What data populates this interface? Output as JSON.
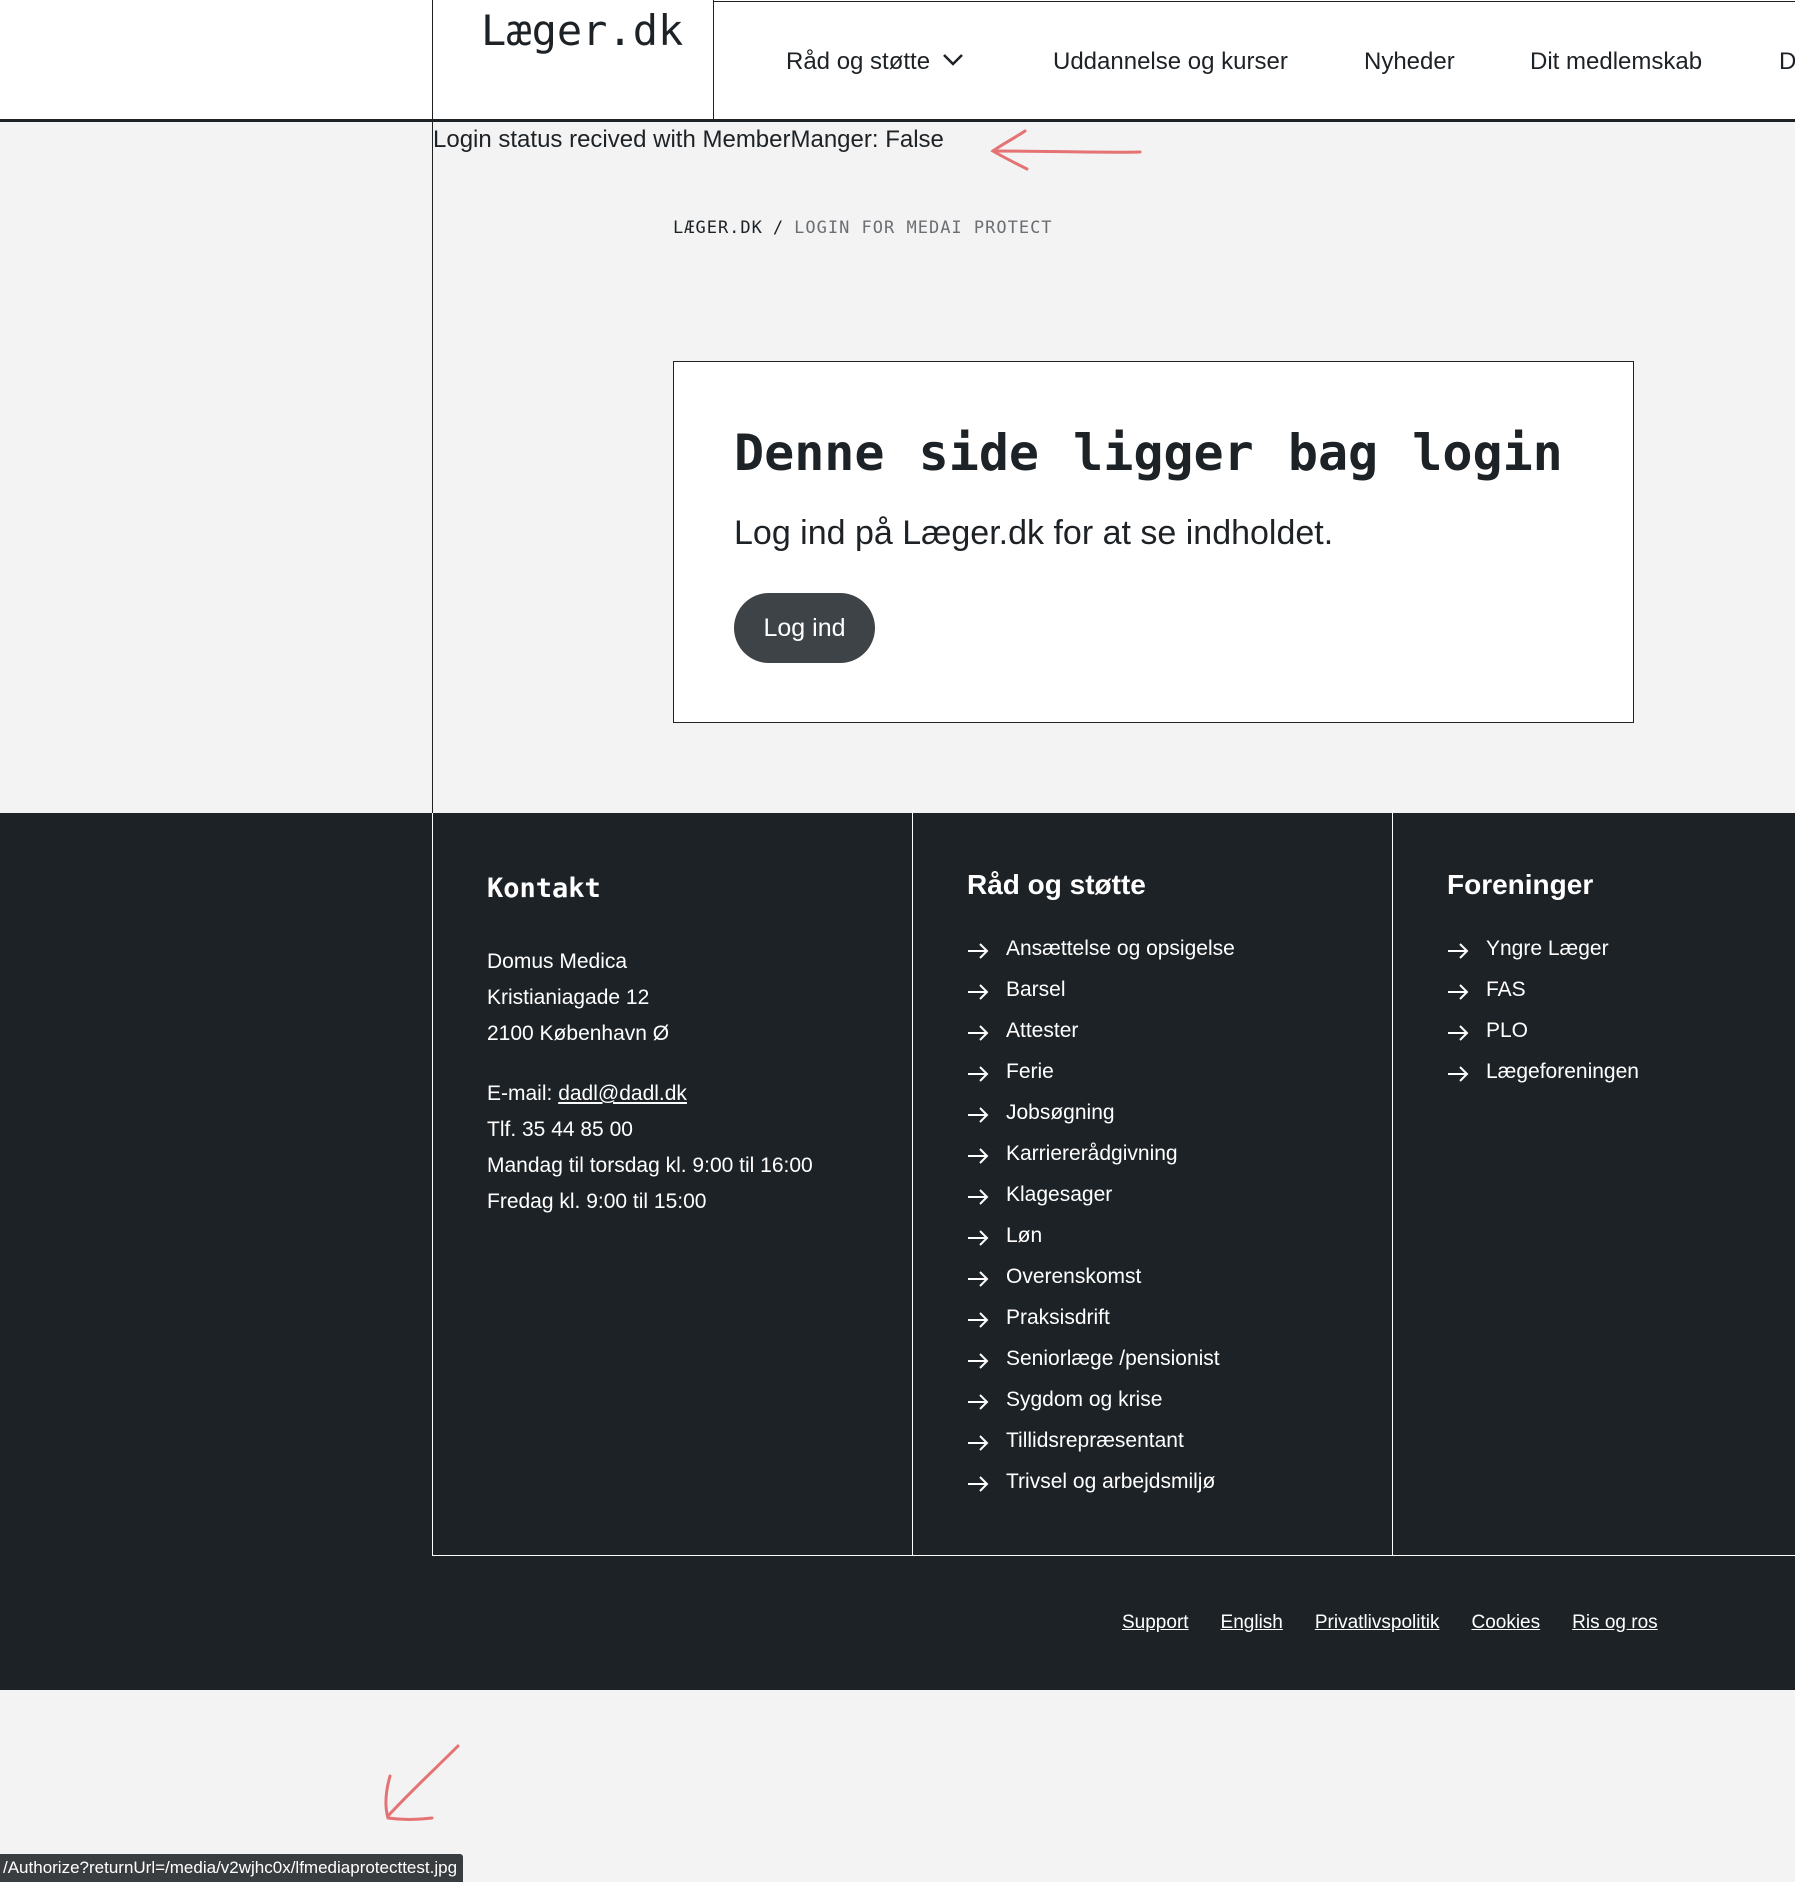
{
  "header": {
    "logo": "Læger.dk",
    "nav": [
      {
        "label": "Råd og støtte",
        "has_dropdown": true
      },
      {
        "label": "Uddannelse og kurser"
      },
      {
        "label": "Nyheder"
      },
      {
        "label": "Dit medlemskab"
      },
      {
        "label": "D"
      }
    ]
  },
  "login_status": "Login status recived with MemberManger: False",
  "breadcrumb": {
    "home": "LÆGER.DK",
    "separator": "/",
    "current": "LOGIN FOR MEDAI PROTECT"
  },
  "card": {
    "title": "Denne side ligger bag login",
    "text": "Log ind på Læger.dk for at se indholdet.",
    "button": "Log ind"
  },
  "footer": {
    "contact": {
      "heading": "Kontakt",
      "address": [
        "Domus Medica",
        "Kristianiagade 12",
        "2100 København Ø"
      ],
      "email_label": "E-mail: ",
      "email": "dadl@dadl.dk",
      "phone": "Tlf. 35 44 85 00",
      "hours": [
        "Mandag til torsdag kl. 9:00 til 16:00",
        "Fredag kl. 9:00 til 15:00"
      ]
    },
    "support": {
      "heading": "Råd og støtte",
      "items": [
        "Ansættelse og opsigelse",
        "Barsel",
        "Attester",
        "Ferie",
        "Jobsøgning",
        "Karriererådgivning",
        "Klagesager",
        "Løn",
        "Overenskomst",
        "Praksisdrift",
        "Seniorlæge /pensionist",
        "Sygdom og krise",
        "Tillidsrepræsentant",
        "Trivsel og arbejdsmiljø"
      ]
    },
    "associations": {
      "heading": "Foreninger",
      "items": [
        "Yngre Læger",
        "FAS",
        "PLO",
        "Lægeforeningen"
      ]
    },
    "bottom_links": [
      "Support",
      "English",
      "Privatlivspolitik",
      "Cookies",
      "Ris og ros"
    ]
  },
  "status_bar_url": "/Authorize?returnUrl=/media/v2wjhc0x/lfmediaprotecttest.jpg",
  "colors": {
    "dark": "#1d2226",
    "button": "#3e4347",
    "background": "#f3f3f3",
    "annotation": "#e57373"
  }
}
